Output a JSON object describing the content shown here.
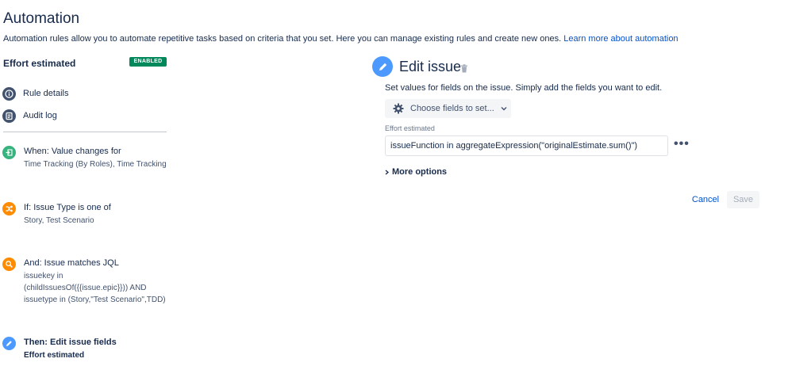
{
  "header": {
    "title": "Automation",
    "description": "Automation rules allow you to automate repetitive tasks based on criteria that you set. Here you can manage existing rules and create new ones.",
    "learn_more": "Learn more about automation"
  },
  "rule": {
    "name": "Effort estimated",
    "status": "ENABLED"
  },
  "nav": {
    "items": [
      {
        "label": "Rule details",
        "icon": "info-icon"
      },
      {
        "label": "Audit log",
        "icon": "audit-log-icon"
      }
    ]
  },
  "steps": [
    {
      "title": "When: Value changes for",
      "detail": [
        "Time Tracking (By Roles), Time Tracking"
      ],
      "icon": "trigger-icon",
      "color": "#36b37e"
    },
    {
      "title": "If: Issue Type is one of",
      "detail": [
        "Story, Test Scenario"
      ],
      "icon": "condition-shuffle-icon",
      "color": "#ff8b00"
    },
    {
      "title": "And: Issue matches JQL",
      "detail": [
        "issuekey in",
        "(childIssuesOf({{issue.epic}})) AND",
        "issuetype in (Story,\"Test Scenario\",TDD)"
      ],
      "icon": "search-icon",
      "color": "#ff8b00"
    },
    {
      "title": "Then: Edit issue fields",
      "detail": [
        "Effort estimated"
      ],
      "icon": "pencil-icon",
      "color": "#4c9aff"
    }
  ],
  "edit": {
    "title": "Edit issue",
    "description": "Set values for fields on the issue. Simply add the fields you want to edit.",
    "choose_fields": "Choose fields to set...",
    "field_label": "Effort estimated",
    "field_value": "issueFunction in aggregateExpression(\"originalEstimate.sum()\")",
    "more_options": "More options",
    "cancel": "Cancel",
    "save": "Save"
  }
}
